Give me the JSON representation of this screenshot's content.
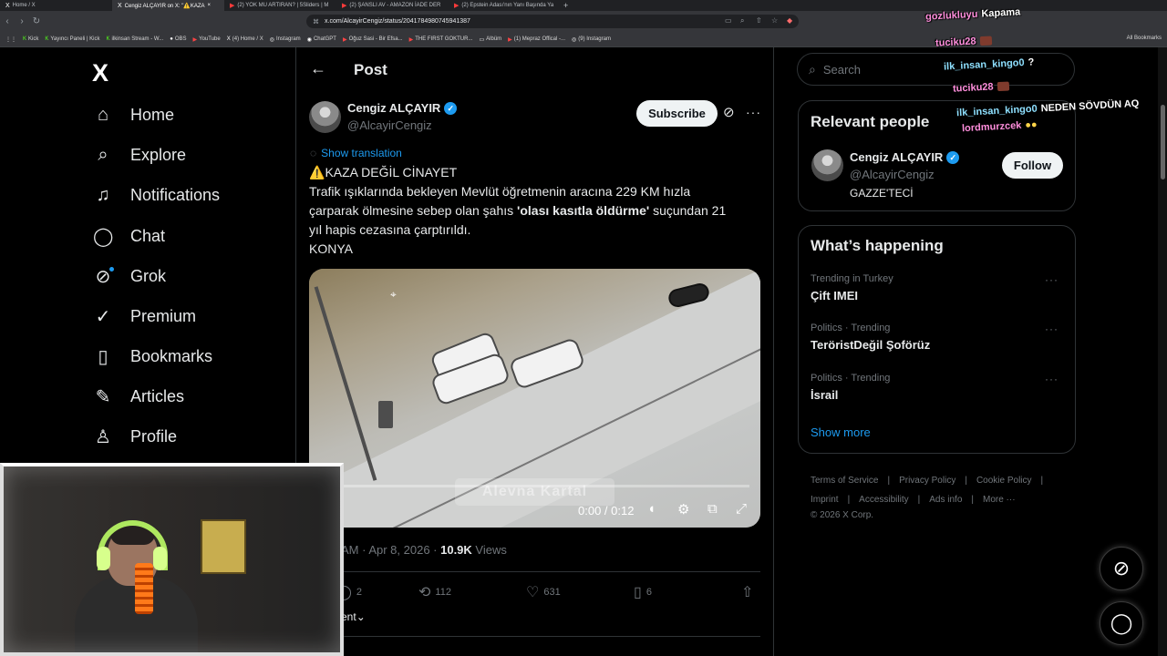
{
  "browser": {
    "tabs": [
      {
        "title": "Home / X",
        "icon": "X"
      },
      {
        "title": "Cengiz ALÇAYIR on X: \"⚠️KAZA",
        "icon": "X",
        "active": true
      },
      {
        "title": "(2) YOK MU ARTIRAN? | 5Sliders | M",
        "icon": "▶"
      },
      {
        "title": "(2) ŞANSLI AV - AMAZON İADE DER",
        "icon": "▶"
      },
      {
        "title": "(2) Epstein Adası'nın Yanı Başında Ya",
        "icon": "▶"
      }
    ],
    "url": "x.com/AlcayirCengiz/status/2041784980745941387",
    "bookmarks": [
      {
        "label": "Kick",
        "icon": "K"
      },
      {
        "label": "Yayıncı Paneli | Kick",
        "icon": "K"
      },
      {
        "label": "ilkinsan Stream - W...",
        "icon": "K"
      },
      {
        "label": "OBS",
        "icon": "●"
      },
      {
        "label": "YouTube",
        "icon": "▶"
      },
      {
        "label": "(4) Home / X",
        "icon": "X"
      },
      {
        "label": "Instagram",
        "icon": "◎"
      },
      {
        "label": "ChatGPT",
        "icon": "◉"
      },
      {
        "label": "Oğuz Sasi - Bir Efsa...",
        "icon": "▶"
      },
      {
        "label": "THE FIRST GOKTUR...",
        "icon": "▶"
      },
      {
        "label": "Albüm",
        "icon": "▭"
      },
      {
        "label": "(1) Mepraz Offical -...",
        "icon": "▶"
      },
      {
        "label": "(9) Instagram",
        "icon": "◎"
      }
    ],
    "all_bookmarks": "All Bookmarks"
  },
  "left_nav": {
    "logo": "X",
    "items": [
      {
        "label": "Home",
        "icon": "home-icon",
        "glyph": "⌂"
      },
      {
        "label": "Explore",
        "icon": "search-icon",
        "glyph": "⌕"
      },
      {
        "label": "Notifications",
        "icon": "bell-icon",
        "glyph": "♫"
      },
      {
        "label": "Chat",
        "icon": "chat-icon",
        "glyph": "◯"
      },
      {
        "label": "Grok",
        "icon": "grok-icon",
        "glyph": "⊘"
      },
      {
        "label": "Premium",
        "icon": "premium-icon",
        "glyph": "✓"
      },
      {
        "label": "Bookmarks",
        "icon": "bookmark-icon",
        "glyph": "▯"
      },
      {
        "label": "Articles",
        "icon": "articles-icon",
        "glyph": "✎"
      },
      {
        "label": "Profile",
        "icon": "profile-icon",
        "glyph": "♙"
      }
    ]
  },
  "post": {
    "header_title": "Post",
    "author": {
      "name": "Cengiz ALÇAYIR",
      "handle": "@AlcayirCengiz"
    },
    "subscribe_label": "Subscribe",
    "translate_label": "Show translation",
    "text": {
      "line1_icon": "⚠️",
      "line1": "KAZA DEĞİL CİNAYET",
      "line2": "Trafik ışıklarında bekleyen Mevlüt öğretmenin aracına 229 KM hızla",
      "line3_pre": "çarparak ölmesine sebep olan şahıs ",
      "line3_bold": "'olası kasıtla öldürme'",
      "line3_post": " suçundan 21",
      "line4": "yıl hapis cezasına çarptırıldı.",
      "line5": "KONYA"
    },
    "video": {
      "watermark": "Alevna Kartal",
      "time": "0:00 / 0:12",
      "progress": 0.0
    },
    "meta": {
      "time_date": "AM · Apr 8, 2026 · ",
      "views": "10.9K",
      "views_label": " Views"
    },
    "actions": [
      {
        "name": "reply",
        "count": "2",
        "glyph": "◯"
      },
      {
        "name": "repost",
        "count": "112",
        "glyph": "⟲"
      },
      {
        "name": "like",
        "count": "631",
        "glyph": "♡"
      },
      {
        "name": "bookmark",
        "count": "6",
        "glyph": "▯"
      },
      {
        "name": "share",
        "count": "",
        "glyph": "⇧"
      }
    ],
    "sort_label": "ent"
  },
  "right": {
    "search_placeholder": "Search",
    "relevant_people_title": "Relevant people",
    "relevant_person": {
      "name": "Cengiz ALÇAYIR",
      "handle": "@AlcayirCengiz",
      "bio": "GAZZE'TECİ",
      "follow_label": "Follow"
    },
    "happening_title": "What’s happening",
    "trends": [
      {
        "category": "Trending in Turkey",
        "name": "Çift IMEI"
      },
      {
        "category": "Politics · Trending",
        "name": "TeröristDeğil Şoförüz"
      },
      {
        "category": "Politics · Trending",
        "name": "İsrail"
      }
    ],
    "show_more": "Show more",
    "footer": {
      "links": [
        "Terms of Service",
        "Privacy Policy",
        "Cookie Policy",
        "Imprint",
        "Accessibility",
        "Ads info",
        "More ···"
      ],
      "copyright": "© 2026 X Corp."
    }
  },
  "stream_chat": [
    {
      "user": "gozlukluyu",
      "message": "Kapama",
      "color": "pink"
    },
    {
      "user": "tuciku28",
      "message": "",
      "color": "pink"
    },
    {
      "user": "ilk_insan_kingo0",
      "message": "?",
      "color": "blue"
    },
    {
      "user": "tuciku28",
      "message": "",
      "color": "pink"
    },
    {
      "user": "ilk_insan_kingo0",
      "message": "NEDEN SÖVDÜN AQ",
      "color": "blue"
    },
    {
      "user": "lordmurzcek",
      "message": "",
      "color": "pink"
    }
  ],
  "colors": {
    "background": "#000000",
    "accent": "#1d9bf0",
    "border": "#2f3336",
    "muted": "#71767b",
    "text": "#e7e9ea",
    "button_bg": "#eff3f4"
  }
}
